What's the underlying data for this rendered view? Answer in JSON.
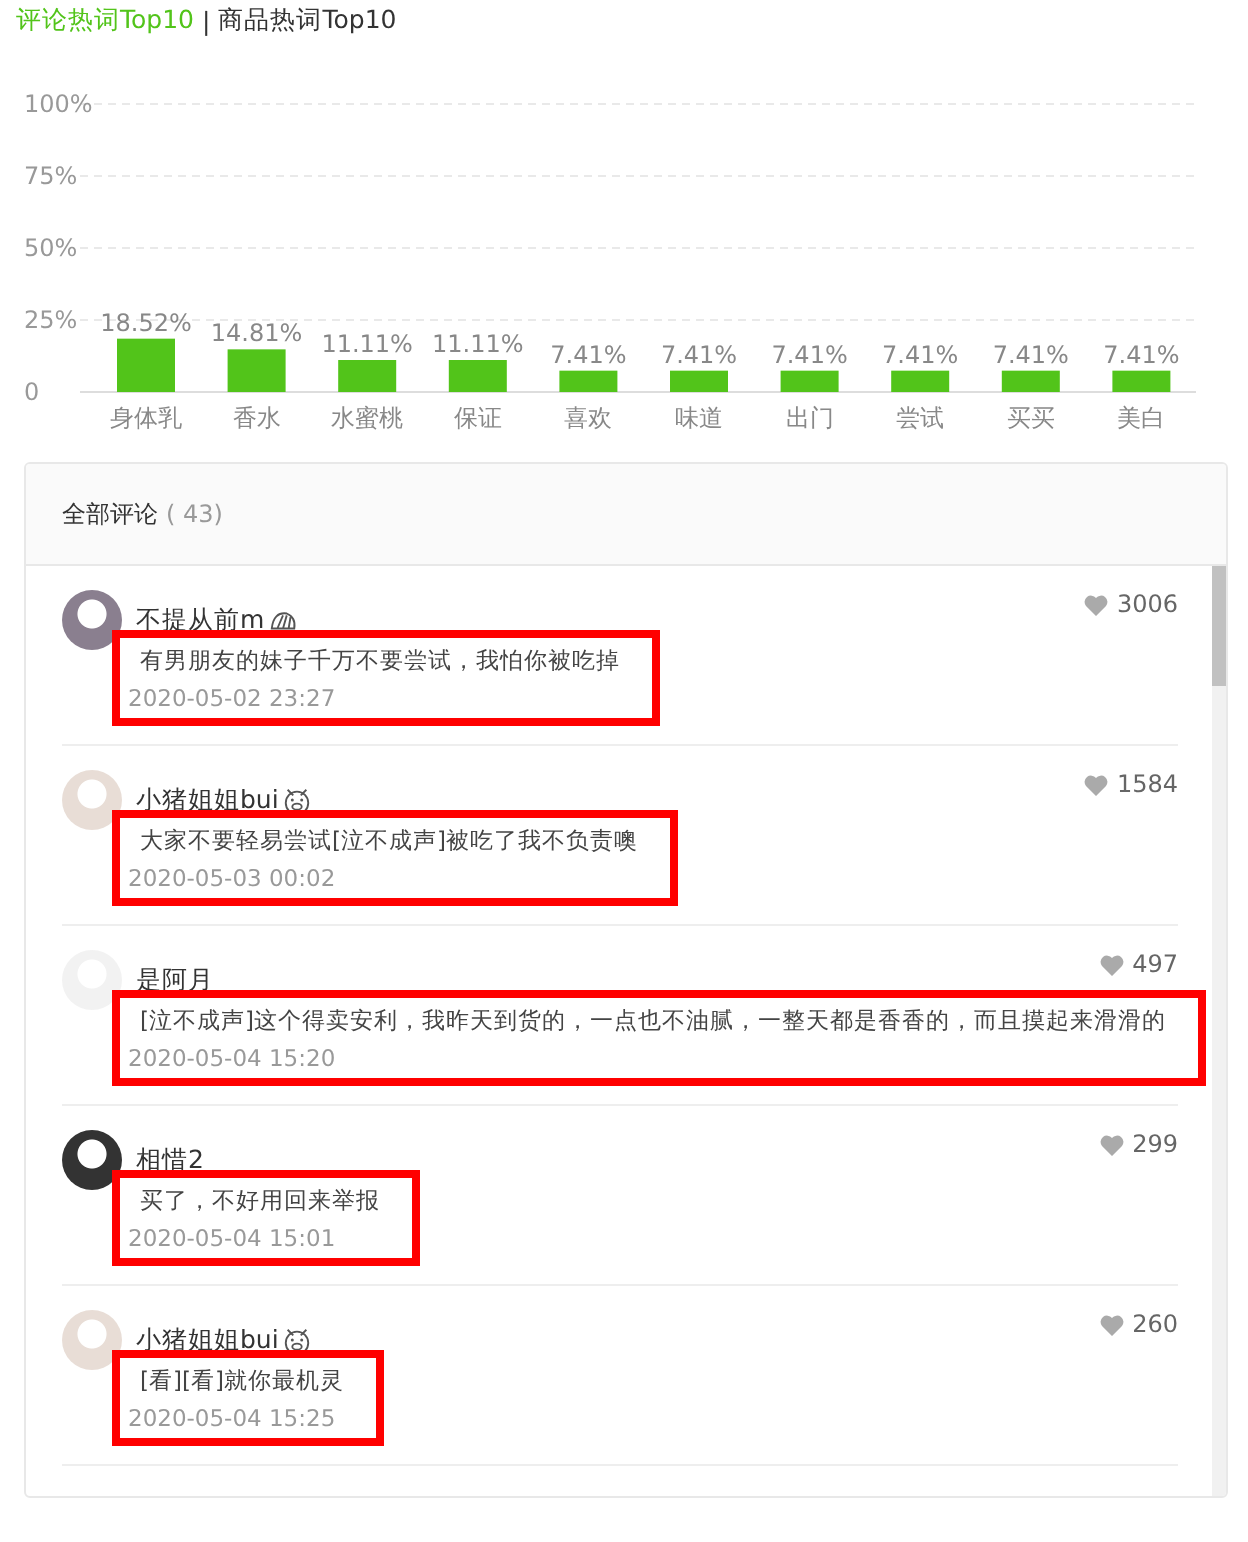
{
  "tabs": [
    {
      "label": "评论热词Top10",
      "selected": true
    },
    {
      "label": "商品热词Top10",
      "selected": false
    }
  ],
  "tab_separator": "|",
  "chart_data": {
    "type": "bar",
    "categories": [
      "身体乳",
      "香水",
      "水蜜桃",
      "保证",
      "喜欢",
      "味道",
      "出门",
      "尝试",
      "买买",
      "美白"
    ],
    "values": [
      18.52,
      14.81,
      11.11,
      11.11,
      7.41,
      7.41,
      7.41,
      7.41,
      7.41,
      7.41
    ],
    "value_labels": [
      "18.52%",
      "14.81%",
      "11.11%",
      "11.11%",
      "7.41%",
      "7.41%",
      "7.41%",
      "7.41%",
      "7.41%",
      "7.41%"
    ],
    "ylim": [
      0,
      100
    ],
    "grid": true,
    "yticks": [
      {
        "value": 0,
        "label": "0"
      },
      {
        "value": 25,
        "label": "25%"
      },
      {
        "value": 50,
        "label": "50%"
      },
      {
        "value": 75,
        "label": "75%"
      },
      {
        "value": 100,
        "label": "100%"
      }
    ],
    "color": "#52c41a"
  },
  "comments_panel": {
    "title": "全部评论",
    "count": "( 43)",
    "comments": [
      {
        "user": "不提从前m",
        "badge": {
          "kind": "shell"
        },
        "likes": "3006",
        "text": "有男朋友的妹子千万不要尝试，我怕你被吃掉",
        "date": "2020-05-02 23:27",
        "highlighted": true
      },
      {
        "user": "小猪姐姐bui",
        "badge": {
          "kind": "pig"
        },
        "likes": "1584",
        "text": "大家不要轻易尝试[泣不成声]被吃了我不负责噢",
        "date": "2020-05-03 00:02",
        "highlighted": true
      },
      {
        "user": "是阿月",
        "likes": "497",
        "text": "[泣不成声]这个得卖安利，我昨天到货的，一点也不油腻，一整天都是香香的，而且摸起来滑滑的",
        "date": "2020-05-04 15:20",
        "highlighted": true
      },
      {
        "user": "相惜2",
        "likes": "299",
        "text": "买了，不好用回来举报",
        "date": "2020-05-04 15:01",
        "highlighted": true
      },
      {
        "user": "小猪姐姐bui",
        "badge": {
          "kind": "pig"
        },
        "likes": "260",
        "text": "[看][看]就你最机灵",
        "date": "2020-05-04 15:25",
        "highlighted": true
      }
    ]
  }
}
